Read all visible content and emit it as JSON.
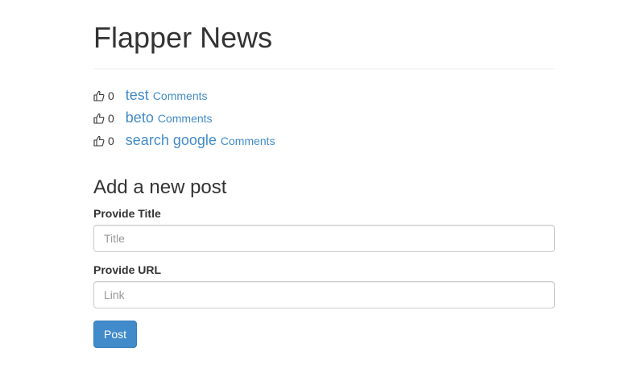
{
  "header": {
    "title": "Flapper News"
  },
  "posts": [
    {
      "upvotes": "0",
      "title": "test",
      "comments_label": "Comments"
    },
    {
      "upvotes": "0",
      "title": "beto",
      "comments_label": "Comments"
    },
    {
      "upvotes": "0",
      "title": "search google",
      "comments_label": "Comments"
    }
  ],
  "form": {
    "heading": "Add a new post",
    "title_label": "Provide Title",
    "title_placeholder": "Title",
    "title_value": "",
    "url_label": "Provide URL",
    "url_placeholder": "Link",
    "url_value": "",
    "submit_label": "Post"
  },
  "icons": {
    "upvote": "thumbs-up-icon"
  },
  "colors": {
    "link": "#428bca",
    "button": "#428bca",
    "text": "#333333"
  }
}
